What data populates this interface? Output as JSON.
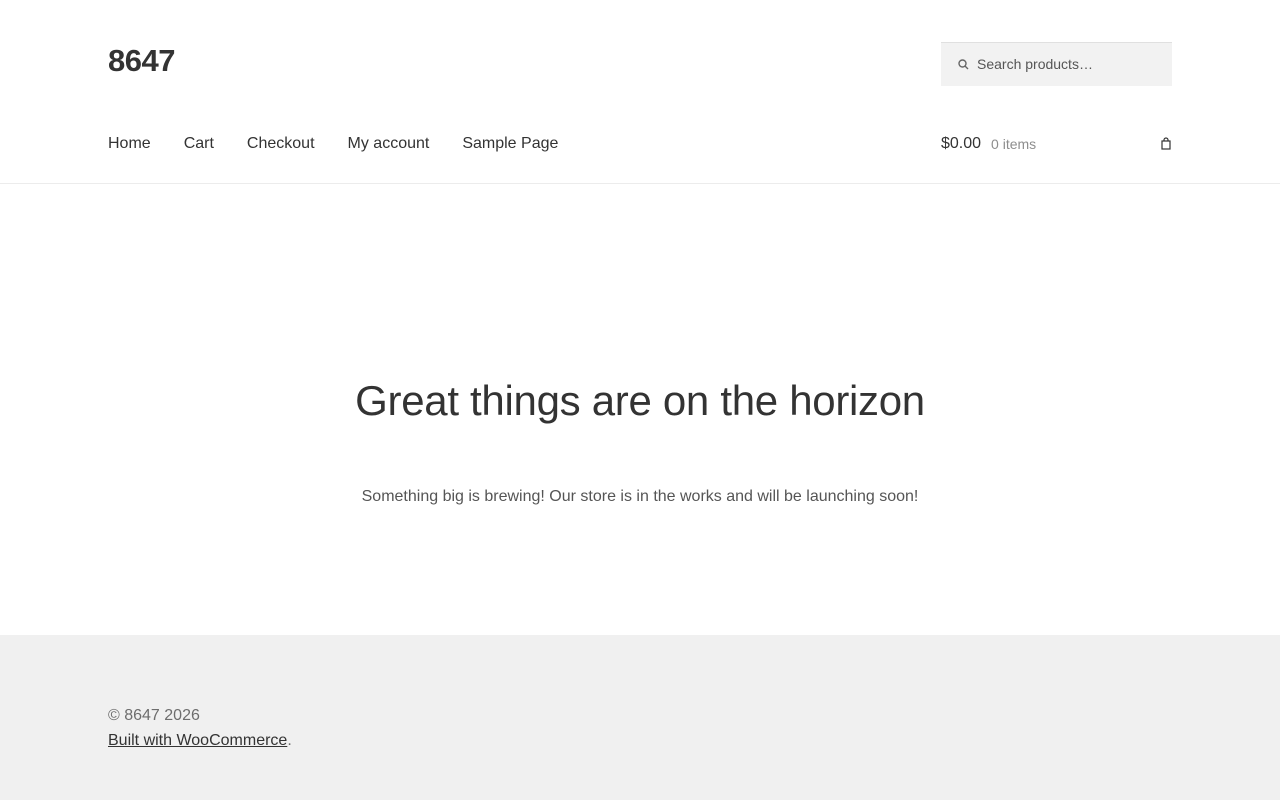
{
  "header": {
    "site_title": "8647",
    "search": {
      "placeholder": "Search products…",
      "value": ""
    }
  },
  "nav": {
    "items": [
      {
        "label": "Home"
      },
      {
        "label": "Cart"
      },
      {
        "label": "Checkout"
      },
      {
        "label": "My account"
      },
      {
        "label": "Sample Page"
      }
    ]
  },
  "cart": {
    "amount": "$0.00",
    "count": "0 items",
    "icon": "shopping-basket-icon"
  },
  "main": {
    "title": "Great things are on the horizon",
    "text": "Something big is brewing! Our store is in the works and will be launching soon!"
  },
  "footer": {
    "copyright": "© 8647 2026",
    "credit_link": "Built with WooCommerce",
    "credit_suffix": "."
  },
  "colors": {
    "text": "#333333",
    "muted": "#6d6d6d",
    "footer_bg": "#f0f0f0",
    "search_bg": "#f2f2f2"
  }
}
